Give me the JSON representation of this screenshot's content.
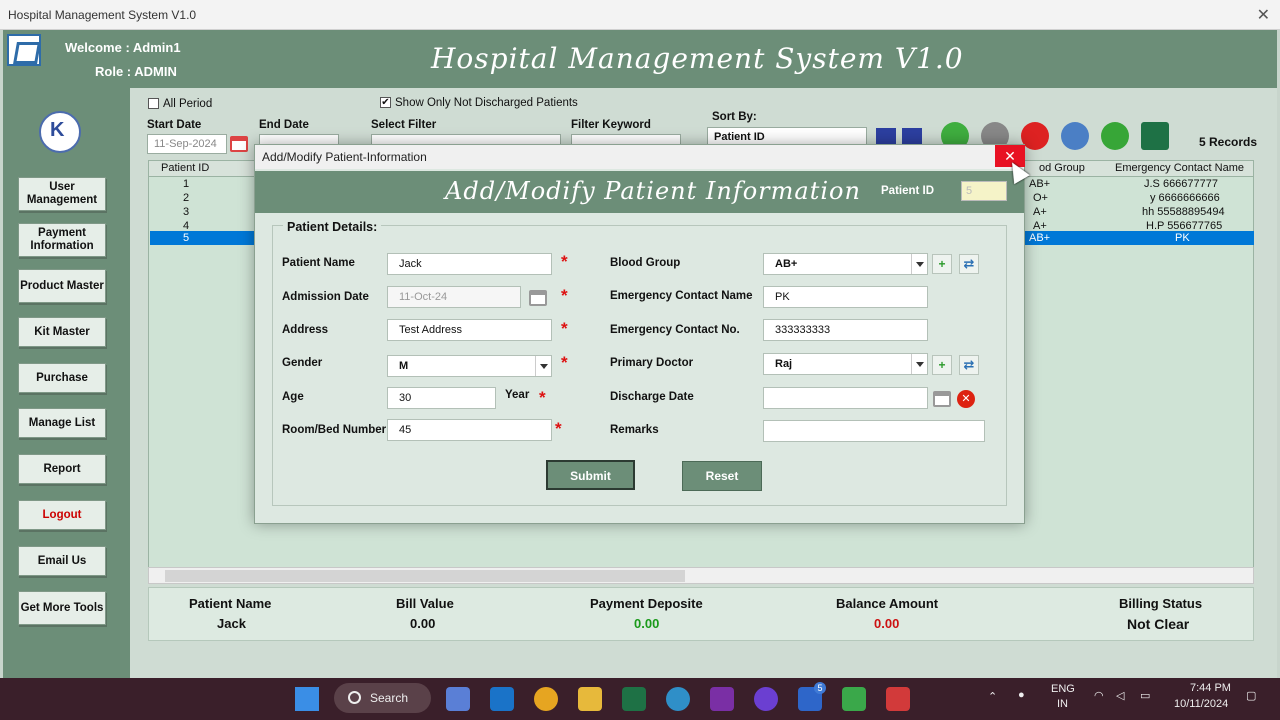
{
  "window": {
    "title": "Hospital Management System V1.0",
    "close": "✕"
  },
  "header": {
    "welcome": "Welcome :  Admin1",
    "role": "Role :  ADMIN",
    "app_title": "Hospital Management System V1.0"
  },
  "sidebar": {
    "items": [
      {
        "label": "User Management"
      },
      {
        "label": "Payment Information"
      },
      {
        "label": "Product Master"
      },
      {
        "label": "Kit Master"
      },
      {
        "label": "Purchase"
      },
      {
        "label": "Manage List"
      },
      {
        "label": "Report"
      },
      {
        "label": "Logout"
      },
      {
        "label": "Email Us"
      },
      {
        "label": "Get More Tools"
      }
    ]
  },
  "filters": {
    "all_period": "All Period",
    "show_not_discharged": "Show Only Not Discharged Patients",
    "start_date_label": "Start Date",
    "start_date": "11-Sep-2024",
    "end_date_label": "End Date",
    "select_filter_label": "Select Filter",
    "filter_keyword_label": "Filter Keyword",
    "sort_by_label": "Sort By:",
    "sort_by": "Patient ID",
    "records": "5 Records"
  },
  "grid": {
    "headers": {
      "patient_id": "Patient ID",
      "blood_group": "od Group",
      "emergency_contact": "Emergency Contact Name"
    },
    "rows": [
      {
        "id": "1",
        "blood": "AB+",
        "contact": "J.S 666677777"
      },
      {
        "id": "2",
        "blood": "O+",
        "contact": "y 6666666666"
      },
      {
        "id": "3",
        "blood": "A+",
        "contact": "hh 55588895494"
      },
      {
        "id": "4",
        "blood": "A+",
        "contact": "H.P 556677765"
      },
      {
        "id": "5",
        "blood": "AB+",
        "contact": "PK"
      }
    ]
  },
  "summary": {
    "patient_name_label": "Patient Name",
    "patient_name": "Jack",
    "bill_value_label": "Bill Value",
    "bill_value": "0.00",
    "payment_deposite_label": "Payment Deposite",
    "payment_deposite": "0.00",
    "balance_amount_label": "Balance Amount",
    "balance_amount": "0.00",
    "billing_status_label": "Billing Status",
    "billing_status": "Not Clear"
  },
  "dialog": {
    "title": "Add/Modify Patient-Information",
    "heading": "Add/Modify Patient Information",
    "patient_id_label": "Patient ID",
    "patient_id": "5",
    "group_caption": "Patient Details:",
    "fields": {
      "patient_name_label": "Patient Name",
      "patient_name": "Jack",
      "admission_date_label": "Admission Date",
      "admission_date": "11-Oct-24",
      "address_label": "Address",
      "address": "Test Address",
      "gender_label": "Gender",
      "gender": "M",
      "age_label": "Age",
      "age": "30",
      "age_unit": "Year",
      "room_label": "Room/Bed Number",
      "room": "45",
      "blood_group_label": "Blood Group",
      "blood_group": "AB+",
      "ec_name_label": "Emergency Contact Name",
      "ec_name": "PK",
      "ec_no_label": "Emergency Contact No.",
      "ec_no": "333333333",
      "doctor_label": "Primary Doctor",
      "doctor": "Raj",
      "discharge_label": "Discharge Date",
      "discharge": "",
      "remarks_label": "Remarks",
      "remarks": ""
    },
    "required_mark": "*",
    "submit": "Submit",
    "reset": "Reset"
  },
  "taskbar": {
    "search": "Search",
    "lang_top": "ENG",
    "lang_bottom": "IN",
    "time": "7:44 PM",
    "date": "10/11/2024",
    "badge": "5"
  }
}
